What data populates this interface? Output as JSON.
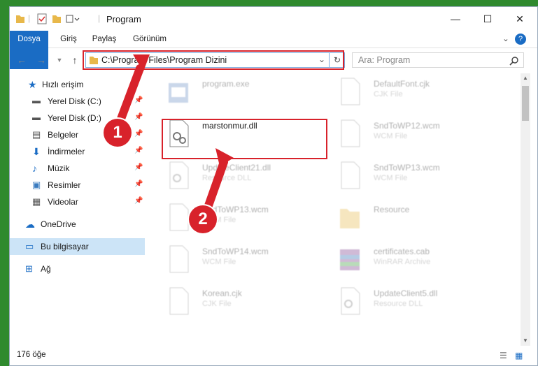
{
  "window": {
    "title": "Program",
    "minimize": "—",
    "maximize": "☐",
    "close": "✕"
  },
  "ribbon": {
    "tabs": [
      "Dosya",
      "Giriş",
      "Paylaş",
      "Görünüm"
    ],
    "expand": "⌄",
    "help": "?"
  },
  "nav": {
    "address": "C:\\Program Files\\Program Dizini",
    "search_placeholder": "Ara: Program"
  },
  "sidebar": {
    "items": [
      {
        "label": "Hızlı erişim"
      },
      {
        "label": "Yerel Disk (C:)"
      },
      {
        "label": "Yerel Disk (D:)"
      },
      {
        "label": "Belgeler"
      },
      {
        "label": "İndirmeler"
      },
      {
        "label": "Müzik"
      },
      {
        "label": "Resimler"
      },
      {
        "label": "Videolar"
      },
      {
        "label": "OneDrive"
      },
      {
        "label": "Bu bilgisayar"
      },
      {
        "label": "Ağ"
      }
    ]
  },
  "files": [
    {
      "name": "program.exe",
      "type": ""
    },
    {
      "name": "DefaultFont.cjk",
      "type": "CJK File"
    },
    {
      "name": "marstonmur.dll",
      "type": ""
    },
    {
      "name": "SndToWP12.wcm",
      "type": "WCM File"
    },
    {
      "name": "UpdateClient21.dll",
      "type": "Resource DLL"
    },
    {
      "name": "SndToWP13.wcm",
      "type": "WCM File"
    },
    {
      "name": "SndToWP13.wcm",
      "type": "WCM File"
    },
    {
      "name": "Resource",
      "type": ""
    },
    {
      "name": "SndToWP14.wcm",
      "type": "WCM File"
    },
    {
      "name": "certificates.cab",
      "type": "WinRAR Archive"
    },
    {
      "name": "Korean.cjk",
      "type": "CJK File"
    },
    {
      "name": "UpdateClient5.dll",
      "type": "Resource DLL"
    }
  ],
  "status": {
    "count": "176 öğe"
  },
  "annotations": {
    "badge1": "1",
    "badge2": "2"
  },
  "colors": {
    "accent": "#1a6cc4",
    "highlight": "#d8222b",
    "selected": "#cce4f7"
  }
}
